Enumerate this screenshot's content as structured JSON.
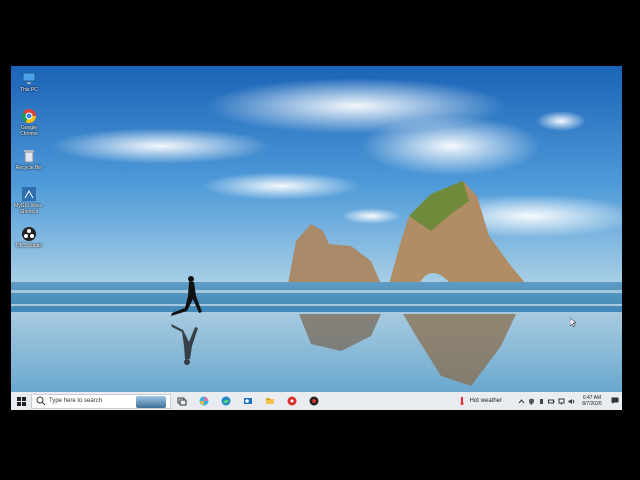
{
  "desktop": {
    "icons": [
      {
        "label": "This PC",
        "icon": "this-pc-icon"
      },
      {
        "label": "Google Chrome",
        "icon": "chrome-icon"
      },
      {
        "label": "Recycle Bin",
        "icon": "recycle-bin-icon"
      },
      {
        "label": "MyGIS Wea - Shortcut",
        "icon": "shortcut-app-icon"
      },
      {
        "label": "OBS Studio",
        "icon": "obs-icon"
      }
    ]
  },
  "taskbar": {
    "search_placeholder": "Type here to search",
    "pinned_icons": [
      "task-view-icon",
      "copilot-icon",
      "edge-icon",
      "outlook-icon",
      "file-explorer-icon",
      "app-red-icon",
      "app-obs-icon"
    ],
    "weather": {
      "text": "Hot weather"
    },
    "clock": {
      "time": "6:47 AM",
      "date": "8/7/2026"
    }
  },
  "colors": {
    "taskbar": "#e9edf1",
    "sky_top": "#1b63b7",
    "sea": "#4b97c4"
  }
}
